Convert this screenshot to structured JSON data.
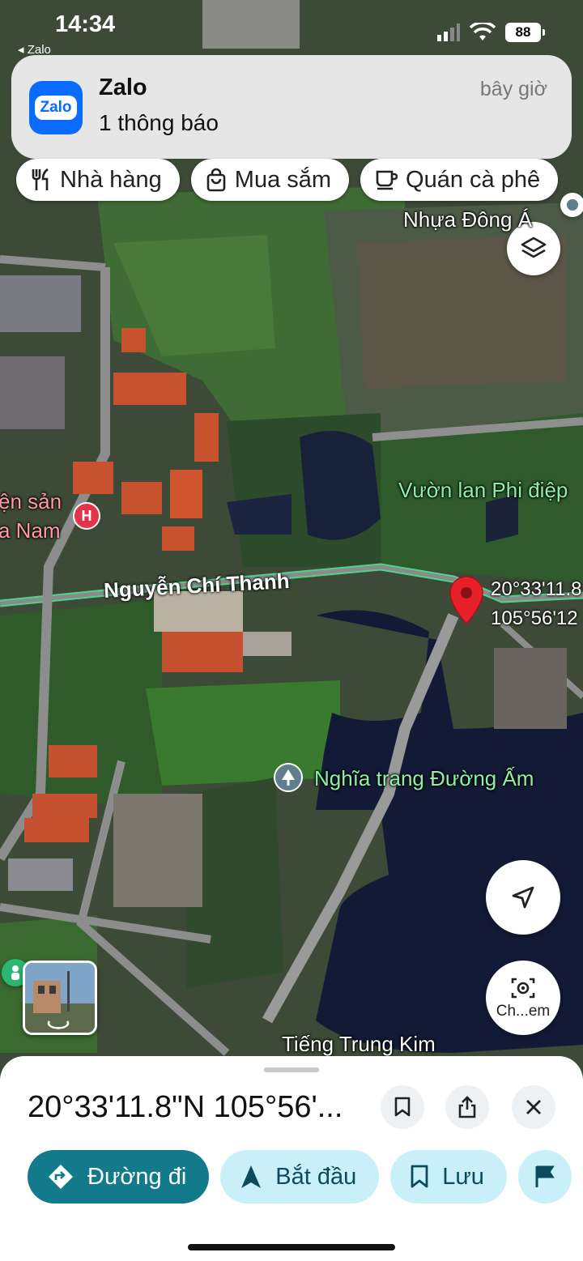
{
  "status_bar": {
    "time": "14:34",
    "back_app": "◂ Zalo",
    "battery": "88"
  },
  "notification": {
    "app_icon_text": "Zalo",
    "app_name": "Zalo",
    "message": "1 thông báo",
    "time": "bây giờ"
  },
  "chips": [
    {
      "label": "Nhà hàng",
      "icon": "restaurant-icon"
    },
    {
      "label": "Mua sắm",
      "icon": "shopping-bag-icon"
    },
    {
      "label": "Quán cà phê",
      "icon": "coffee-icon"
    }
  ],
  "map": {
    "labels": {
      "factory": "Nhựa Đông Á",
      "garden": "Vườn lan Phi điệp",
      "hospital_line1": "ện sản",
      "hospital_line2": "a Nam",
      "road": "Nguyễn Chí Thanh",
      "cemetery": "Nghĩa trang Đường Ấm",
      "school": "Tiếng Trung Kim"
    },
    "pin_coords": {
      "lat": "20°33'11.8",
      "lng": "105°56'12"
    },
    "poi_hospital_letter": "H",
    "search_button_label": "Ch...em"
  },
  "sheet": {
    "title": "20°33'11.8\"N 105°56'...",
    "actions": [
      {
        "label": "Đường đi",
        "icon": "directions-icon"
      },
      {
        "label": "Bắt đầu",
        "icon": "navigation-arrow-icon"
      },
      {
        "label": "Lưu",
        "icon": "bookmark-icon"
      }
    ]
  },
  "colors": {
    "primary": "#127a8a",
    "secondary_bg": "#c9f0f8",
    "pin": "#e8202a",
    "zalo": "#0a6cff"
  }
}
